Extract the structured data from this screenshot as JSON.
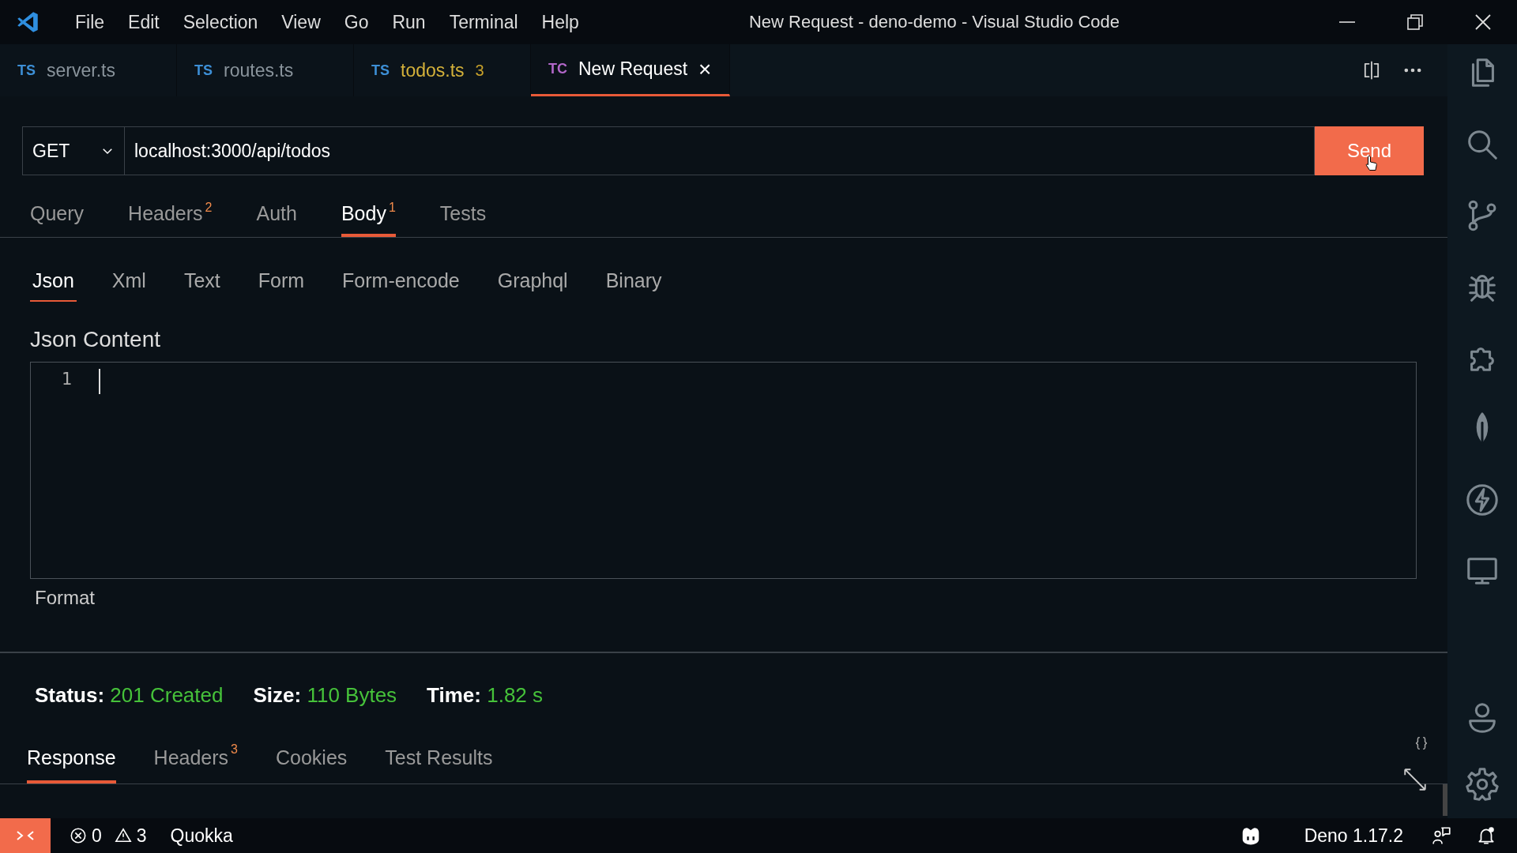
{
  "window": {
    "title": "New Request - deno-demo - Visual Studio Code"
  },
  "menu": [
    "File",
    "Edit",
    "Selection",
    "View",
    "Go",
    "Run",
    "Terminal",
    "Help"
  ],
  "editor_tabs": [
    {
      "icon": "TS",
      "color": "#3d8fd6",
      "label": "server.ts",
      "selected": false,
      "has_problems": false
    },
    {
      "icon": "TS",
      "color": "#3d8fd6",
      "label": "routes.ts",
      "selected": false,
      "has_problems": false
    },
    {
      "icon": "TS",
      "color": "#3d8fd6",
      "label": "todos.ts",
      "problems": "3",
      "selected": false,
      "has_problems": true
    },
    {
      "icon": "TC",
      "color": "#b267c9",
      "label": "New Request",
      "close": "×",
      "selected": true,
      "has_problems": false
    }
  ],
  "request": {
    "method": "GET",
    "url": "localhost:3000/api/todos",
    "send": "Send"
  },
  "request_tabs": [
    {
      "label": "Query",
      "selected": false
    },
    {
      "label": "Headers",
      "badge": "2",
      "selected": false
    },
    {
      "label": "Auth",
      "selected": false
    },
    {
      "label": "Body",
      "badge": "1",
      "selected": true
    },
    {
      "label": "Tests",
      "selected": false
    }
  ],
  "body_types": [
    {
      "label": "Json",
      "selected": true
    },
    {
      "label": "Xml",
      "selected": false
    },
    {
      "label": "Text",
      "selected": false
    },
    {
      "label": "Form",
      "selected": false
    },
    {
      "label": "Form-encode",
      "selected": false
    },
    {
      "label": "Graphql",
      "selected": false
    },
    {
      "label": "Binary",
      "selected": false
    }
  ],
  "content_label": "Json Content",
  "editor": {
    "line_numbers": [
      "1"
    ]
  },
  "format": "Format",
  "response_stats": [
    {
      "label": "Status:",
      "value": "201 Created"
    },
    {
      "label": "Size:",
      "value": "110 Bytes"
    },
    {
      "label": "Time:",
      "value": "1.82 s"
    }
  ],
  "response_tabs": [
    {
      "label": "Response",
      "selected": true
    },
    {
      "label": "Headers",
      "badge": "3",
      "selected": false
    },
    {
      "label": "Cookies",
      "selected": false
    },
    {
      "label": "Test Results",
      "selected": false
    }
  ],
  "status_bar": {
    "errors": "0",
    "warnings": "3",
    "quokka": "Quokka",
    "deno": "Deno 1.17.2"
  }
}
